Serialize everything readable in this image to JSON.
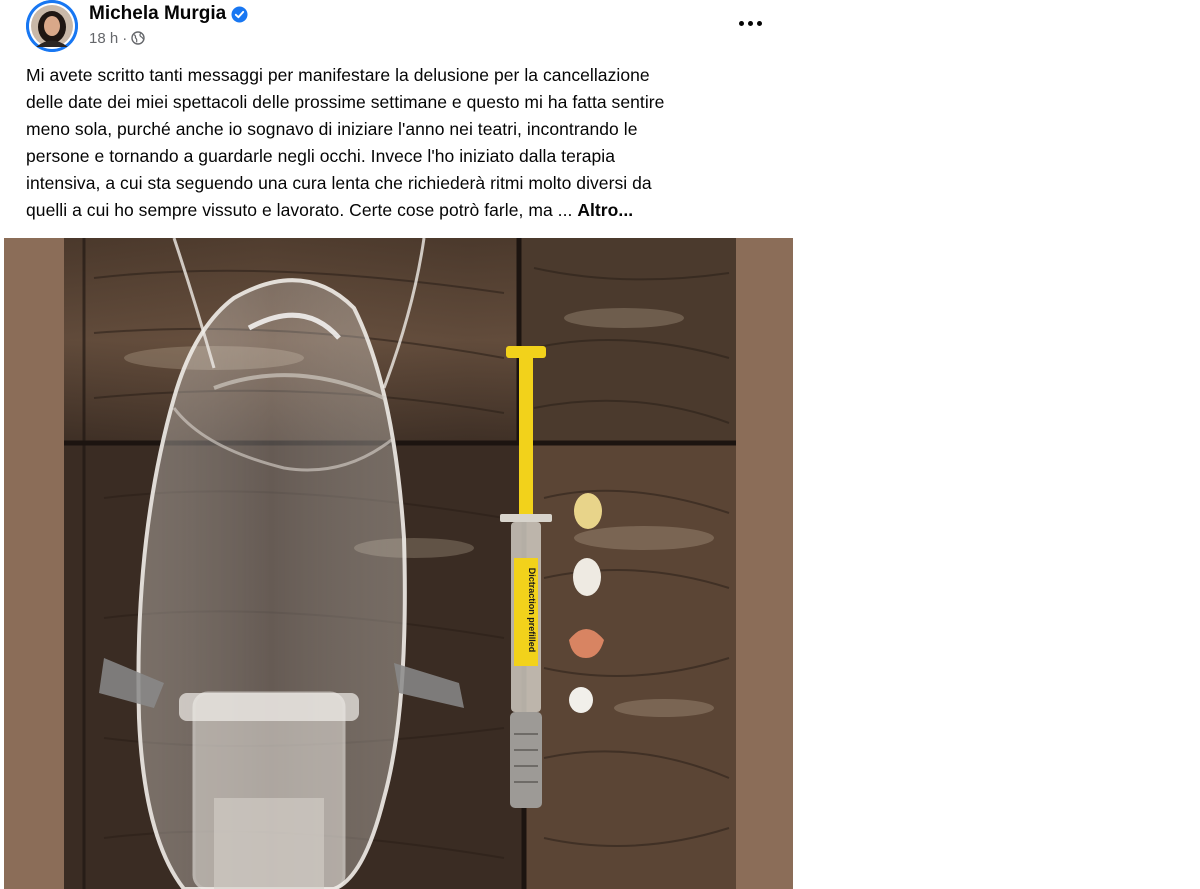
{
  "post": {
    "author": "Michela Murgia",
    "time": "18 h",
    "separator": "·",
    "text_lines": [
      "Mi avete scritto tanti messaggi per manifestare la delusione per la cancellazione",
      "delle date dei miei spettacoli delle prossime settimane e questo mi ha fatta sentire",
      "meno sola, purché anche io sognavo di iniziare l'anno nei teatri, incontrando le",
      "persone e tornando a guardarle negli occhi. Invece l'ho iniziato dalla terapia",
      "intensiva, a cui sta seguendo una cura lenta che richiederà ritmi molto diversi da",
      "quelli a cui ho sempre vissuto e lavorato. Certe cose potrò farle, ma ... "
    ],
    "more_link": "Altro..."
  },
  "photo": {
    "label_text": "Dictraction prefilled"
  },
  "colors": {
    "brand_blue": "#1877f2",
    "meta_gray": "#65676b",
    "frame_brown": "#8b6d58",
    "syringe_yellow": "#f2d21b"
  },
  "icons": {
    "verified": "verified-badge-icon",
    "audience": "globe-icon",
    "more": "more-options-icon"
  }
}
